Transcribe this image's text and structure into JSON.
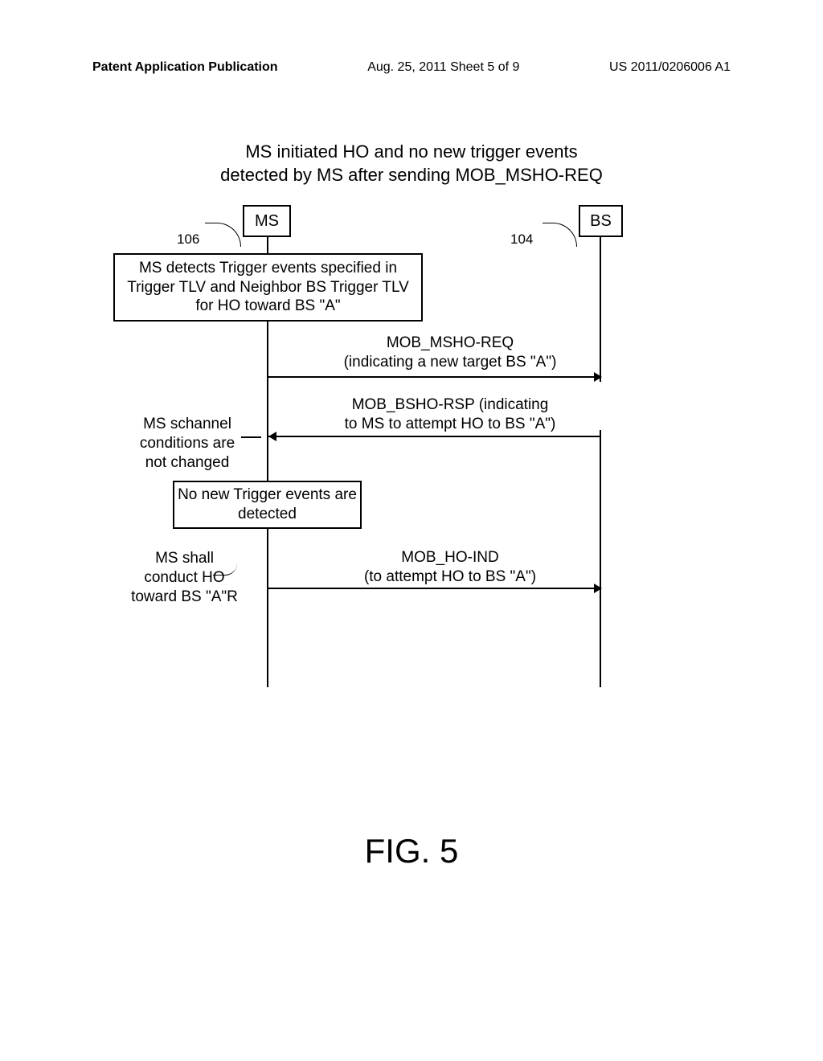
{
  "header": {
    "left": "Patent Application Publication",
    "center": "Aug. 25, 2011  Sheet 5 of 9",
    "right": "US 2011/0206006 A1"
  },
  "title": {
    "line1": "MS initiated HO and no new trigger events",
    "line2": "detected by MS after sending MOB_MSHO-REQ"
  },
  "nodes": {
    "ms": "MS",
    "bs": "BS",
    "ms_ref": "106",
    "bs_ref": "104"
  },
  "boxes": {
    "trigger": "MS detects Trigger events specified in Trigger TLV and Neighbor BS Trigger TLV for HO toward BS \"A\"",
    "no_trigger": "No new Trigger events are detected"
  },
  "messages": {
    "msg1_line1": "MOB_MSHO-REQ",
    "msg1_line2": "(indicating a new target BS \"A\")",
    "msg2_line1": "MOB_BSHO-RSP (indicating",
    "msg2_line2": "to MS to attempt HO to BS \"A\")",
    "msg3_line1": "MOB_HO-IND",
    "msg3_line2": "(to attempt HO to BS \"A\")"
  },
  "side_notes": {
    "note1_line1": "MS schannel",
    "note1_line2": "conditions are",
    "note1_line3": "not changed",
    "note2_line1": "MS shall",
    "note2_line2": "conduct HO",
    "note2_line3": "toward BS \"A\"R"
  },
  "figure": "FIG. 5",
  "chart_data": {
    "type": "sequence_diagram",
    "title": "MS initiated HO and no new trigger events detected by MS after sending MOB_MSHO-REQ",
    "participants": [
      {
        "name": "MS",
        "ref": "106"
      },
      {
        "name": "BS",
        "ref": "104"
      }
    ],
    "events": [
      {
        "type": "box",
        "at": "MS",
        "text": "MS detects Trigger events specified in Trigger TLV and Neighbor BS Trigger TLV for HO toward BS \"A\""
      },
      {
        "type": "message",
        "from": "MS",
        "to": "BS",
        "text": "MOB_MSHO-REQ (indicating a new target BS \"A\")"
      },
      {
        "type": "message",
        "from": "BS",
        "to": "MS",
        "text": "MOB_BSHO-RSP (indicating to MS to attempt HO to BS \"A\")",
        "note": "MS schannel conditions are not changed"
      },
      {
        "type": "box",
        "at": "MS",
        "text": "No new Trigger events are detected"
      },
      {
        "type": "message",
        "from": "MS",
        "to": "BS",
        "text": "MOB_HO-IND (to attempt HO to BS \"A\")",
        "note": "MS shall conduct HO toward BS \"A\"R"
      }
    ]
  }
}
